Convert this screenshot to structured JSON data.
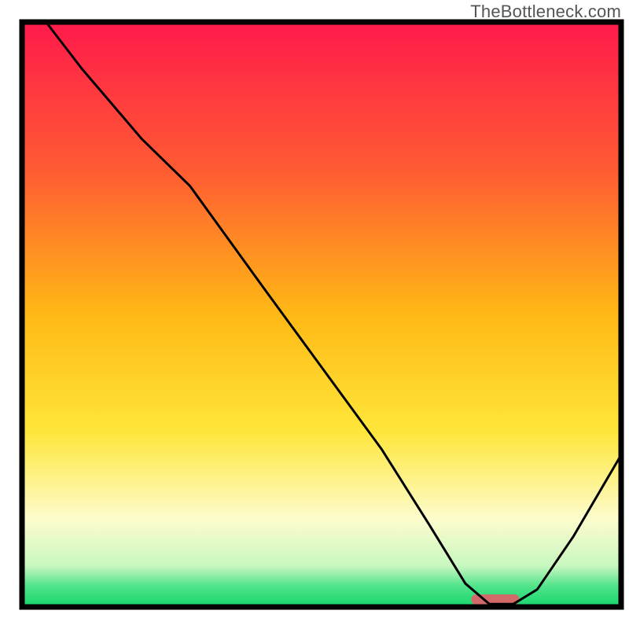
{
  "watermark": "TheBottleneck.com",
  "chart_data": {
    "type": "line",
    "title": "",
    "xlabel": "",
    "ylabel": "",
    "xlim": [
      0,
      100
    ],
    "ylim": [
      0,
      100
    ],
    "series": [
      {
        "name": "bottleneck-curve",
        "x": [
          4,
          10,
          20,
          28,
          40,
          50,
          60,
          68,
          74,
          78,
          82,
          86,
          92,
          100
        ],
        "y": [
          100,
          92,
          80,
          72,
          55,
          41,
          27,
          14,
          4,
          0.5,
          0.5,
          3,
          12,
          26
        ]
      }
    ],
    "marker": {
      "name": "optimal-range",
      "x_start": 75,
      "x_end": 83,
      "color": "#d36a6a"
    },
    "gradient_stops": [
      {
        "offset": 0,
        "color": "#ff1a4b"
      },
      {
        "offset": 0.25,
        "color": "#ff5a33"
      },
      {
        "offset": 0.5,
        "color": "#ffb915"
      },
      {
        "offset": 0.7,
        "color": "#ffe63a"
      },
      {
        "offset": 0.85,
        "color": "#fdfccd"
      },
      {
        "offset": 0.93,
        "color": "#c8f7c0"
      },
      {
        "offset": 0.965,
        "color": "#4fe38a"
      },
      {
        "offset": 1.0,
        "color": "#16d66d"
      }
    ],
    "border_color": "#000000",
    "border_width": 7,
    "line_color": "#000000",
    "line_width": 3
  }
}
